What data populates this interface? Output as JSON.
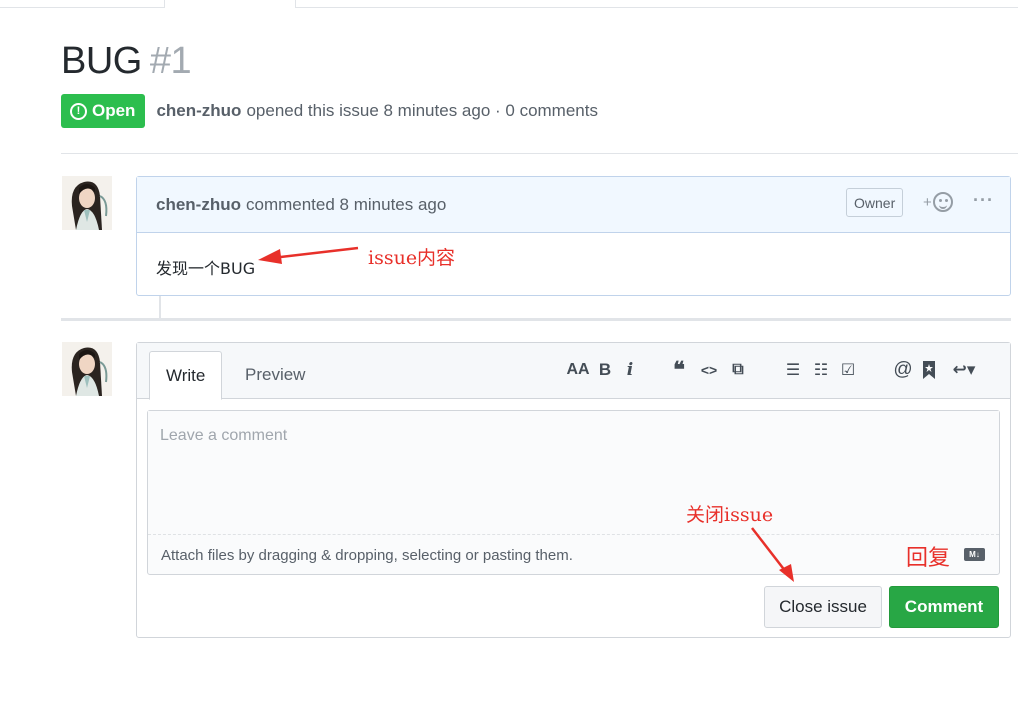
{
  "issue": {
    "title": "BUG",
    "number": "#1",
    "state_label": "Open",
    "state_icon": "!",
    "author": "chen-zhuo",
    "summary": "opened this issue 8 minutes ago · 0 comments"
  },
  "comment": {
    "author": "chen-zhuo",
    "timestamp_text": "commented 8 minutes ago",
    "role_badge": "Owner",
    "reaction_plus": "+",
    "more_label": "···",
    "body": "发现一个BUG"
  },
  "new_comment": {
    "tabs": [
      {
        "label": "Write"
      },
      {
        "label": "Preview"
      }
    ],
    "toolbar": {
      "header": "AA",
      "bold": "B",
      "italic": "i",
      "quote": "❝",
      "code": "<>",
      "link": "⧉",
      "bullet_list": "☰",
      "numbered_list": "☷",
      "task_list": "☑",
      "mention": "@",
      "reference": "🔖",
      "reply": "↩▾"
    },
    "placeholder": "Leave a comment",
    "attach_text": "Attach files by dragging & dropping, selecting or pasting them.",
    "markdown_badge": "M↓",
    "close_button": "Close issue",
    "comment_button": "Comment"
  },
  "annotations": {
    "issue_content": "issue内容",
    "close_issue": "关闭issue",
    "reply": "回复"
  },
  "colors": {
    "open_green": "#2cbe4e",
    "comment_green": "#28a745",
    "annotation_red": "#e8302a",
    "header_blue": "#f1f8ff"
  }
}
